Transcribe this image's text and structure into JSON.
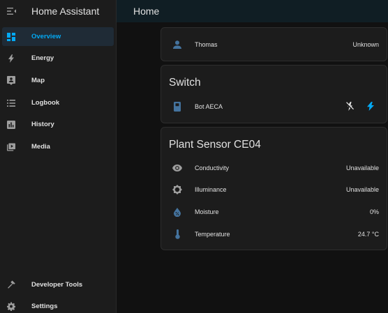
{
  "app": {
    "title": "Home Assistant"
  },
  "topbar": {
    "title": "Home"
  },
  "sidebar": {
    "items": [
      {
        "label": "Overview",
        "icon": "view-dashboard-icon",
        "active": true
      },
      {
        "label": "Energy",
        "icon": "lightning-icon"
      },
      {
        "label": "Map",
        "icon": "map-person-icon"
      },
      {
        "label": "Logbook",
        "icon": "list-icon"
      },
      {
        "label": "History",
        "icon": "chart-box-icon"
      },
      {
        "label": "Media",
        "icon": "play-box-icon"
      }
    ],
    "bottom_items": [
      {
        "label": "Developer Tools",
        "icon": "hammer-icon"
      },
      {
        "label": "Settings",
        "icon": "cog-icon"
      }
    ]
  },
  "cards": {
    "person": {
      "name": "Thomas",
      "state": "Unknown",
      "icon": "account-icon"
    },
    "switch": {
      "title": "Switch",
      "entity": {
        "name": "Bot AECA",
        "icon": "remote-icon",
        "actions": [
          "flash-off-icon",
          "flash-icon"
        ]
      }
    },
    "plant": {
      "title": "Plant Sensor CE04",
      "rows": [
        {
          "name": "Conductivity",
          "state": "Unavailable",
          "icon": "eye-icon"
        },
        {
          "name": "Illuminance",
          "state": "Unavailable",
          "icon": "brightness-icon"
        },
        {
          "name": "Moisture",
          "state": "0%",
          "icon": "water-percent-icon"
        },
        {
          "name": "Temperature",
          "state": "24.7 °C",
          "icon": "thermometer-icon"
        }
      ]
    }
  },
  "colors": {
    "accent": "#03a9f4",
    "sidebar_bg": "#1c1c1c",
    "card_bg": "#1c1c1c",
    "topbar_bg": "#101e24",
    "page_bg": "#111111",
    "icon_grey": "#9e9e9e",
    "state_icon_blue": "#44739e"
  }
}
